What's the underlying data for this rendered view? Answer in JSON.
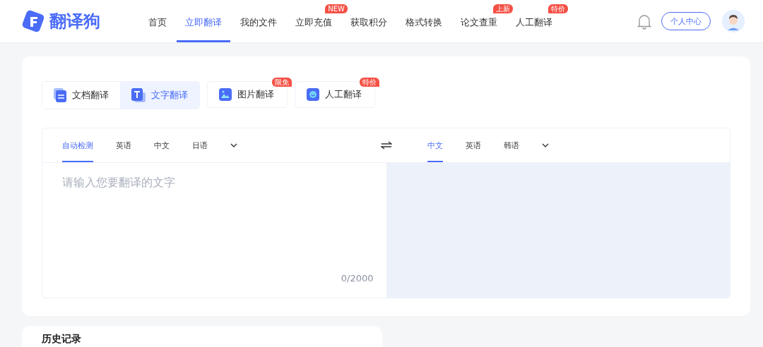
{
  "logo": {
    "text": "翻译狗"
  },
  "nav": [
    {
      "label": "首页",
      "selected": false
    },
    {
      "label": "立即翻译",
      "selected": true
    },
    {
      "label": "我的文件",
      "selected": false
    },
    {
      "label": "立即充值",
      "selected": false,
      "badge": "NEW"
    },
    {
      "label": "获取积分",
      "selected": false
    },
    {
      "label": "格式转换",
      "selected": false
    },
    {
      "label": "论文查重",
      "selected": false,
      "badge": "上新"
    },
    {
      "label": "人工翻译",
      "selected": false,
      "badge": "特价"
    }
  ],
  "user_center_button": "个人中心",
  "mode_tabs": [
    {
      "label": "文档翻译",
      "kind": "doc",
      "selected": false
    },
    {
      "label": "文字翻译",
      "kind": "text",
      "selected": true
    },
    {
      "label": "图片翻译",
      "kind": "image",
      "selected": false,
      "badge": "限免"
    },
    {
      "label": "人工翻译",
      "kind": "human",
      "selected": false,
      "badge": "特价"
    }
  ],
  "source_languages": [
    {
      "label": "自动检测",
      "selected": true
    },
    {
      "label": "英语",
      "selected": false
    },
    {
      "label": "中文",
      "selected": false
    },
    {
      "label": "日语",
      "selected": false
    }
  ],
  "target_languages": [
    {
      "label": "中文",
      "selected": true
    },
    {
      "label": "英语",
      "selected": false
    },
    {
      "label": "韩语",
      "selected": false
    }
  ],
  "input": {
    "placeholder": "请输入您要翻译的文字",
    "counter": "0/2000"
  },
  "history": {
    "title": "历史记录"
  }
}
